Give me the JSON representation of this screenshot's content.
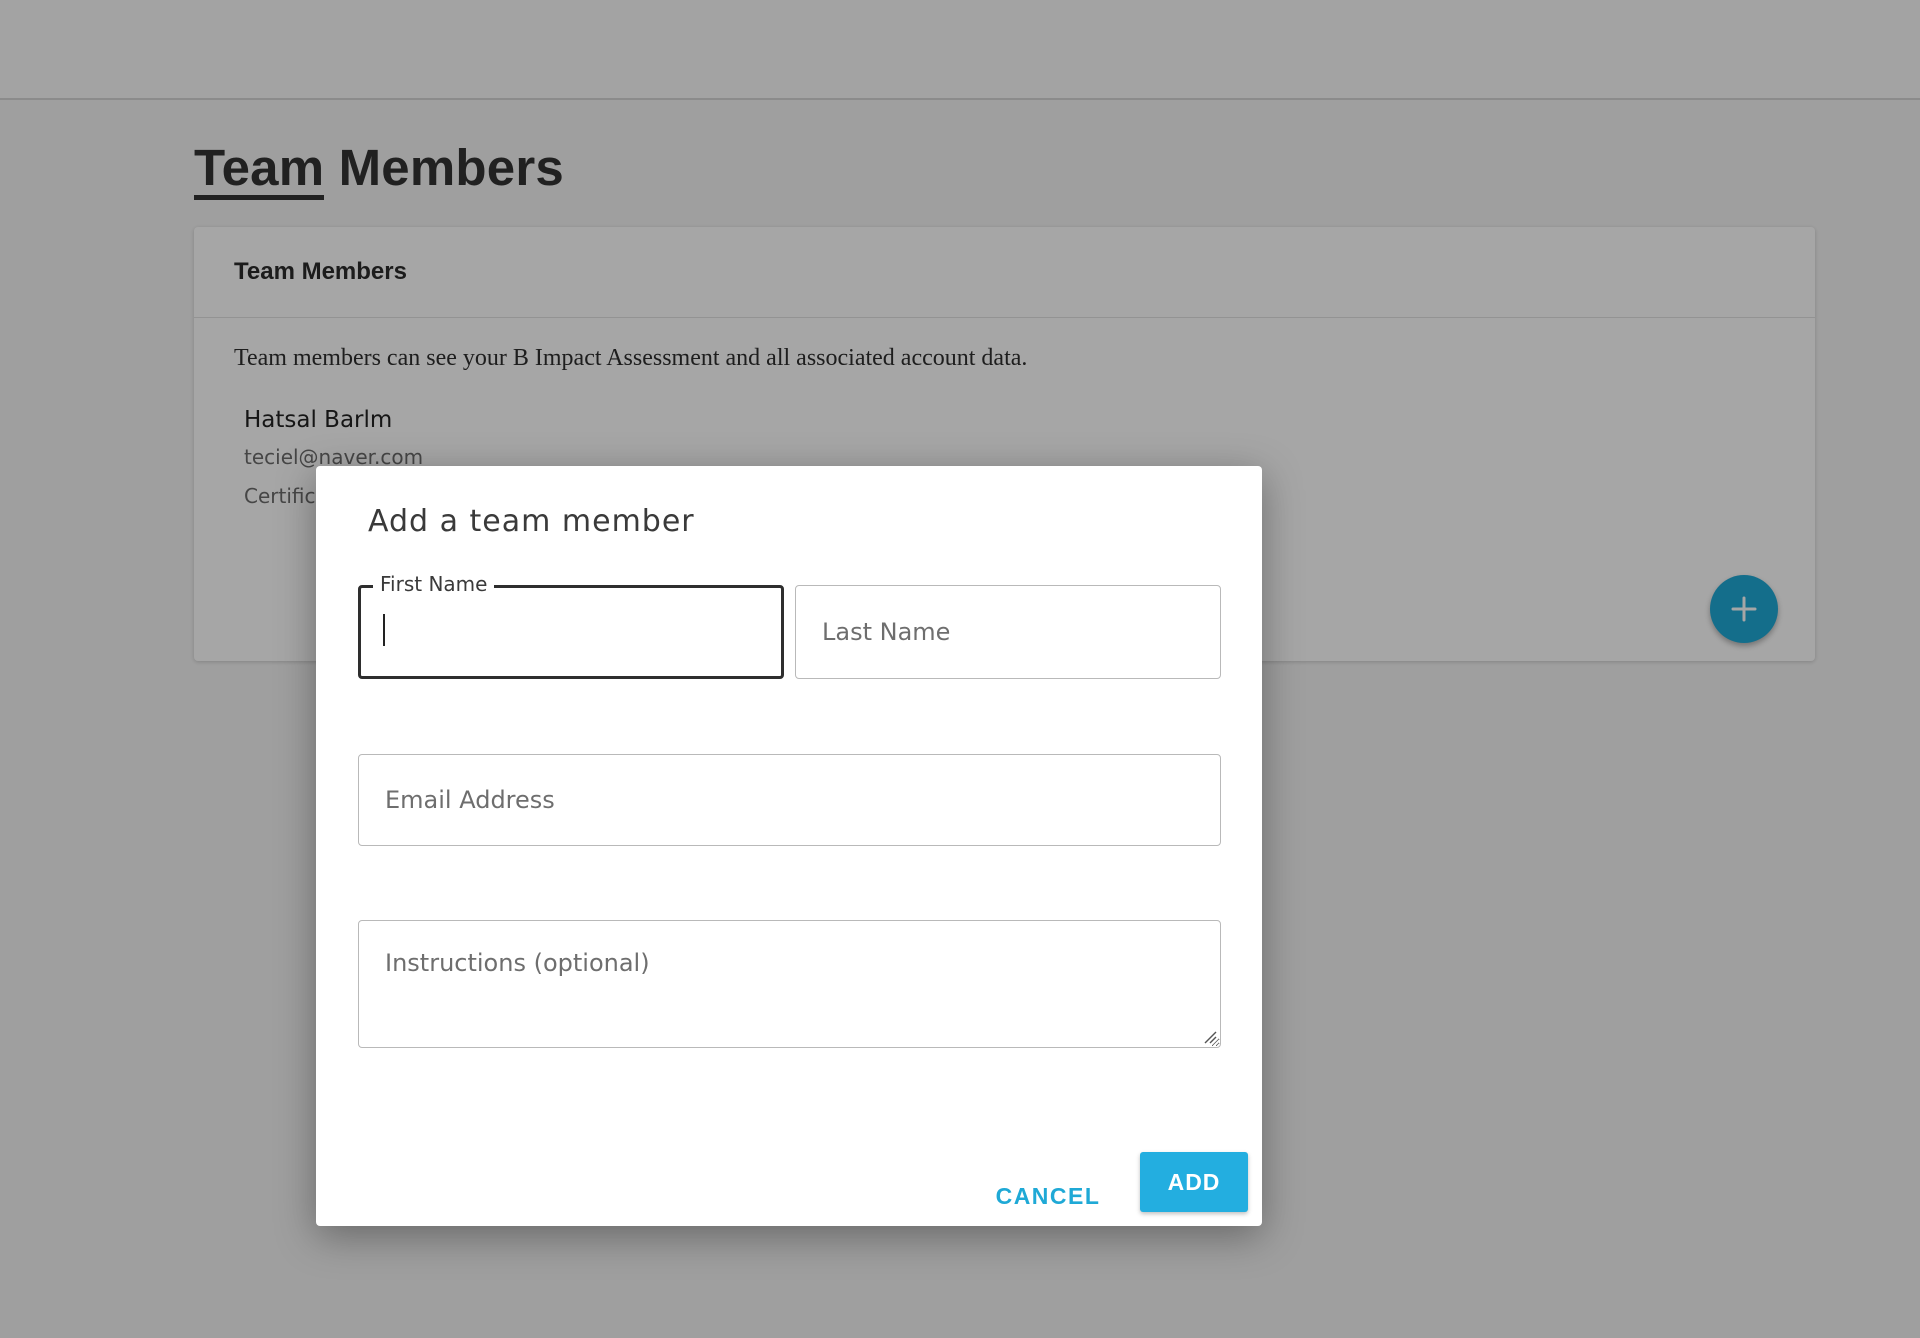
{
  "page": {
    "title_first_word": "Team",
    "title_rest": " Members"
  },
  "card": {
    "header": "Team Members",
    "description": "Team members can see your B Impact Assessment and all associated account data.",
    "member": {
      "name": "Hatsal Barlm",
      "email": "teciel@naver.com",
      "role": "Certific"
    },
    "add_button_icon": "plus-icon"
  },
  "dialog": {
    "title": "Add a team member",
    "first_name": {
      "label": "First Name",
      "value": ""
    },
    "last_name": {
      "placeholder": "Last Name"
    },
    "email": {
      "placeholder": "Email Address"
    },
    "instructions": {
      "placeholder": "Instructions (optional)"
    },
    "cancel_label": "CANCEL",
    "add_label": "ADD"
  },
  "colors": {
    "accent": "#1fa9d6",
    "primary_button": "#23aee0",
    "overlay": "rgba(0,0,0,0.35)"
  }
}
